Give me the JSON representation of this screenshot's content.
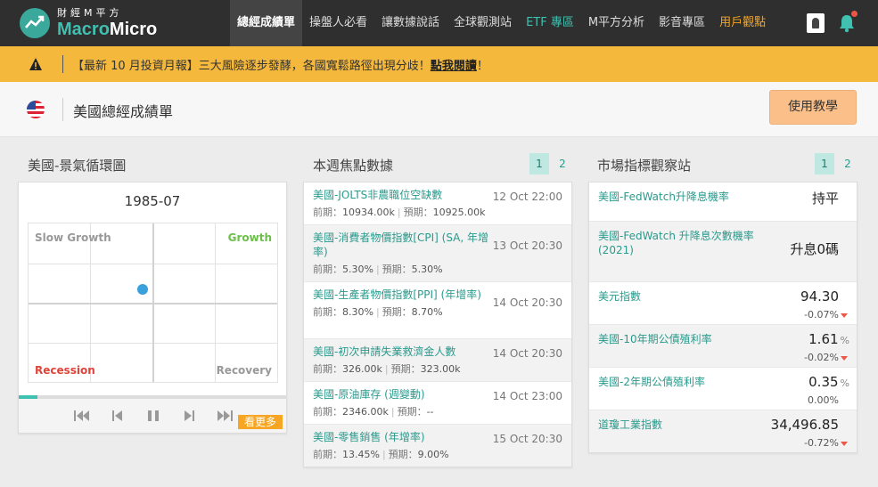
{
  "brand": {
    "name_cn": "財經M平方",
    "name_en_a": "Macro",
    "name_en_b": "Micro"
  },
  "nav": {
    "items": [
      {
        "label": "總經成績單"
      },
      {
        "label": "操盤人必看"
      },
      {
        "label": "讓數據說話"
      },
      {
        "label": "全球觀測站"
      },
      {
        "label": "ETF 專區"
      },
      {
        "label": "M平方分析"
      },
      {
        "label": "影音專區"
      },
      {
        "label": "用戶觀點"
      }
    ]
  },
  "announcement": {
    "text": "【最新 10 月投資月報】三大風險逐步發酵，各國寬鬆路徑出現分歧！",
    "link": "點我閱讀",
    "suffix": "！"
  },
  "subheader": {
    "title": "美國總經成績單",
    "tutorial_button": "使用教學"
  },
  "cycle": {
    "title": "美國-景氣循環圖",
    "date": "1985-07",
    "quadrants": {
      "top_left": "Slow Growth",
      "top_right": "Growth",
      "bottom_left": "Recession",
      "bottom_right": "Recovery"
    },
    "colors": {
      "growth": "#6cc04a",
      "recession": "#e0443a",
      "neutral": "#999999",
      "dot": "#3aa0dc"
    },
    "playback_progress_pct": 7,
    "more_button": "看更多"
  },
  "events": {
    "title": "本週焦點數據",
    "pages": [
      "1",
      "2"
    ],
    "prev_label": "前期：",
    "fcst_label": "預期：",
    "items": [
      {
        "name": "美國-JOLTS非農職位空缺數",
        "time": "12 Oct 22:00",
        "prev": "10934.00k",
        "fcst": "10925.00k"
      },
      {
        "name": "美國-消費者物價指數[CPI] (SA, 年增率)",
        "time": "13 Oct 20:30",
        "prev": "5.30%",
        "fcst": "5.30%"
      },
      {
        "name": "美國-生產者物價指數[PPI] (年增率)",
        "time": "14 Oct 20:30",
        "prev": "8.30%",
        "fcst": "8.70%"
      },
      {
        "name": "美國-初次申請失業救濟金人數",
        "time": "14 Oct 20:30",
        "prev": "326.00k",
        "fcst": "323.00k"
      },
      {
        "name": "美國-原油庫存 (週變動)",
        "time": "14 Oct 23:00",
        "prev": "2346.00k",
        "fcst": "--"
      },
      {
        "name": "美國-零售銷售 (年增率)",
        "time": "15 Oct 20:30",
        "prev": "13.45%",
        "fcst": "9.00%"
      }
    ]
  },
  "market": {
    "title": "市場指標觀察站",
    "pages": [
      "1",
      "2"
    ],
    "items": [
      {
        "name": "美國-FedWatch升降息機率",
        "value": "持平",
        "unit": "",
        "change": ""
      },
      {
        "name": "美國-FedWatch 升降息次數機率 (2021)",
        "value": "升息0碼",
        "unit": "",
        "change": ""
      },
      {
        "name": "美元指數",
        "value": "94.30",
        "unit": "",
        "change": "-0.07%"
      },
      {
        "name": "美國-10年期公債殖利率",
        "value": "1.61",
        "unit": "%",
        "change": "-0.02%"
      },
      {
        "name": "美國-2年期公債殖利率",
        "value": "0.35",
        "unit": "%",
        "change": "0.00%"
      },
      {
        "name": "道瓊工業指數",
        "value": "34,496.85",
        "unit": "",
        "change": "-0.72%"
      }
    ]
  }
}
